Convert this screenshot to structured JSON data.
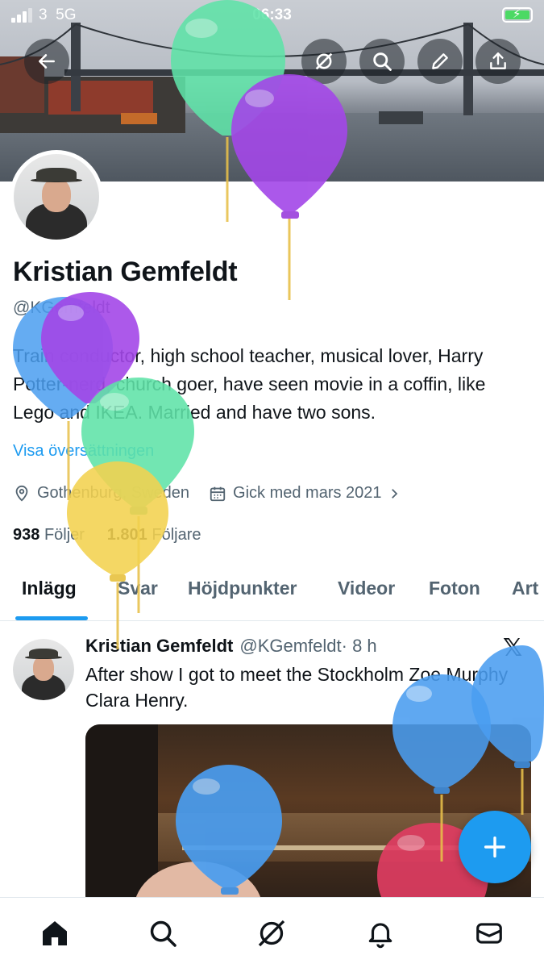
{
  "status_bar": {
    "carrier": "3",
    "network": "5G",
    "time": "06:33"
  },
  "profile": {
    "name": "Kristian Gemfeldt",
    "handle": "@KGemfeldt",
    "bio": "Train conductor, high school teacher, musical lover, Harry Potter-nerd, church goer, have seen movie in a coffin, like Lego and IKEA. Married and have two sons.",
    "translate_link": "Visa översättningen",
    "location": "Gothenburg, Sweden",
    "joined": "Gick med mars 2021",
    "following_count": "938",
    "following_label": "Följer",
    "followers_count": "1.801",
    "followers_label": "Följare"
  },
  "tabs": [
    {
      "label": "Inlägg",
      "active": true
    },
    {
      "label": "Svar",
      "active": false
    },
    {
      "label": "Höjdpunkter",
      "active": false
    },
    {
      "label": "Videor",
      "active": false
    },
    {
      "label": "Foton",
      "active": false
    },
    {
      "label": "Art",
      "active": false
    }
  ],
  "post": {
    "author_name": "Kristian Gemfeldt",
    "author_handle": "@KGemfeldt",
    "time": "· 8 h",
    "text": "After show I got to meet the Stockholm Zoe Murphy Clara Henry.",
    "source_icon": "x-logo"
  },
  "icons": {
    "back": "arrow-left-icon",
    "grok": "grok-icon",
    "search": "search-icon",
    "edit": "pencil-icon",
    "share": "share-icon",
    "compose": "plus-icon",
    "nav": [
      "home-icon",
      "search-icon",
      "grok-icon",
      "bell-icon",
      "mail-icon"
    ]
  },
  "colors": {
    "accent": "#1d9bf0",
    "text": "#0f1419",
    "secondary": "#536471",
    "battery": "#4cd964"
  },
  "balloon_colors": [
    "#5fe3a8",
    "#a347e8",
    "#4a9df0",
    "#f3d24f",
    "#e23d63"
  ]
}
